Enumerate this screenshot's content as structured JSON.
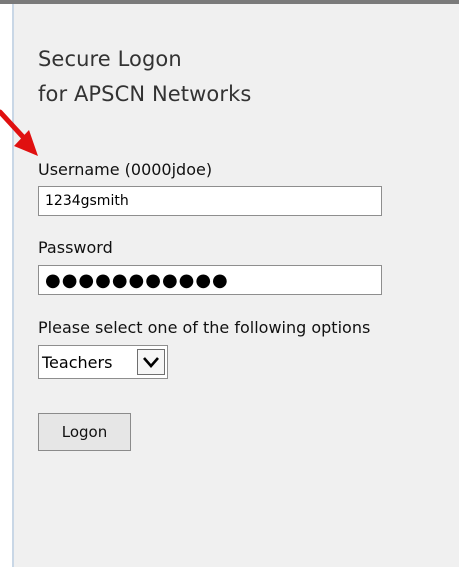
{
  "page": {
    "title_line1": "Secure Logon",
    "title_line2": "for APSCN Networks"
  },
  "form": {
    "username": {
      "label": "Username (0000jdoe)",
      "value": "1234gsmith"
    },
    "password": {
      "label": "Password",
      "masked_value": "●●●●●●●●●●●"
    },
    "options": {
      "label": "Please select one of the following options",
      "selected": "Teachers"
    },
    "submit_label": "Logon"
  },
  "colors": {
    "panel_bg": "#f0f0f0",
    "annotation_arrow": "#e01010"
  },
  "icons": {
    "dropdown": "chevron-down-icon",
    "annotation": "red-arrow-icon"
  }
}
